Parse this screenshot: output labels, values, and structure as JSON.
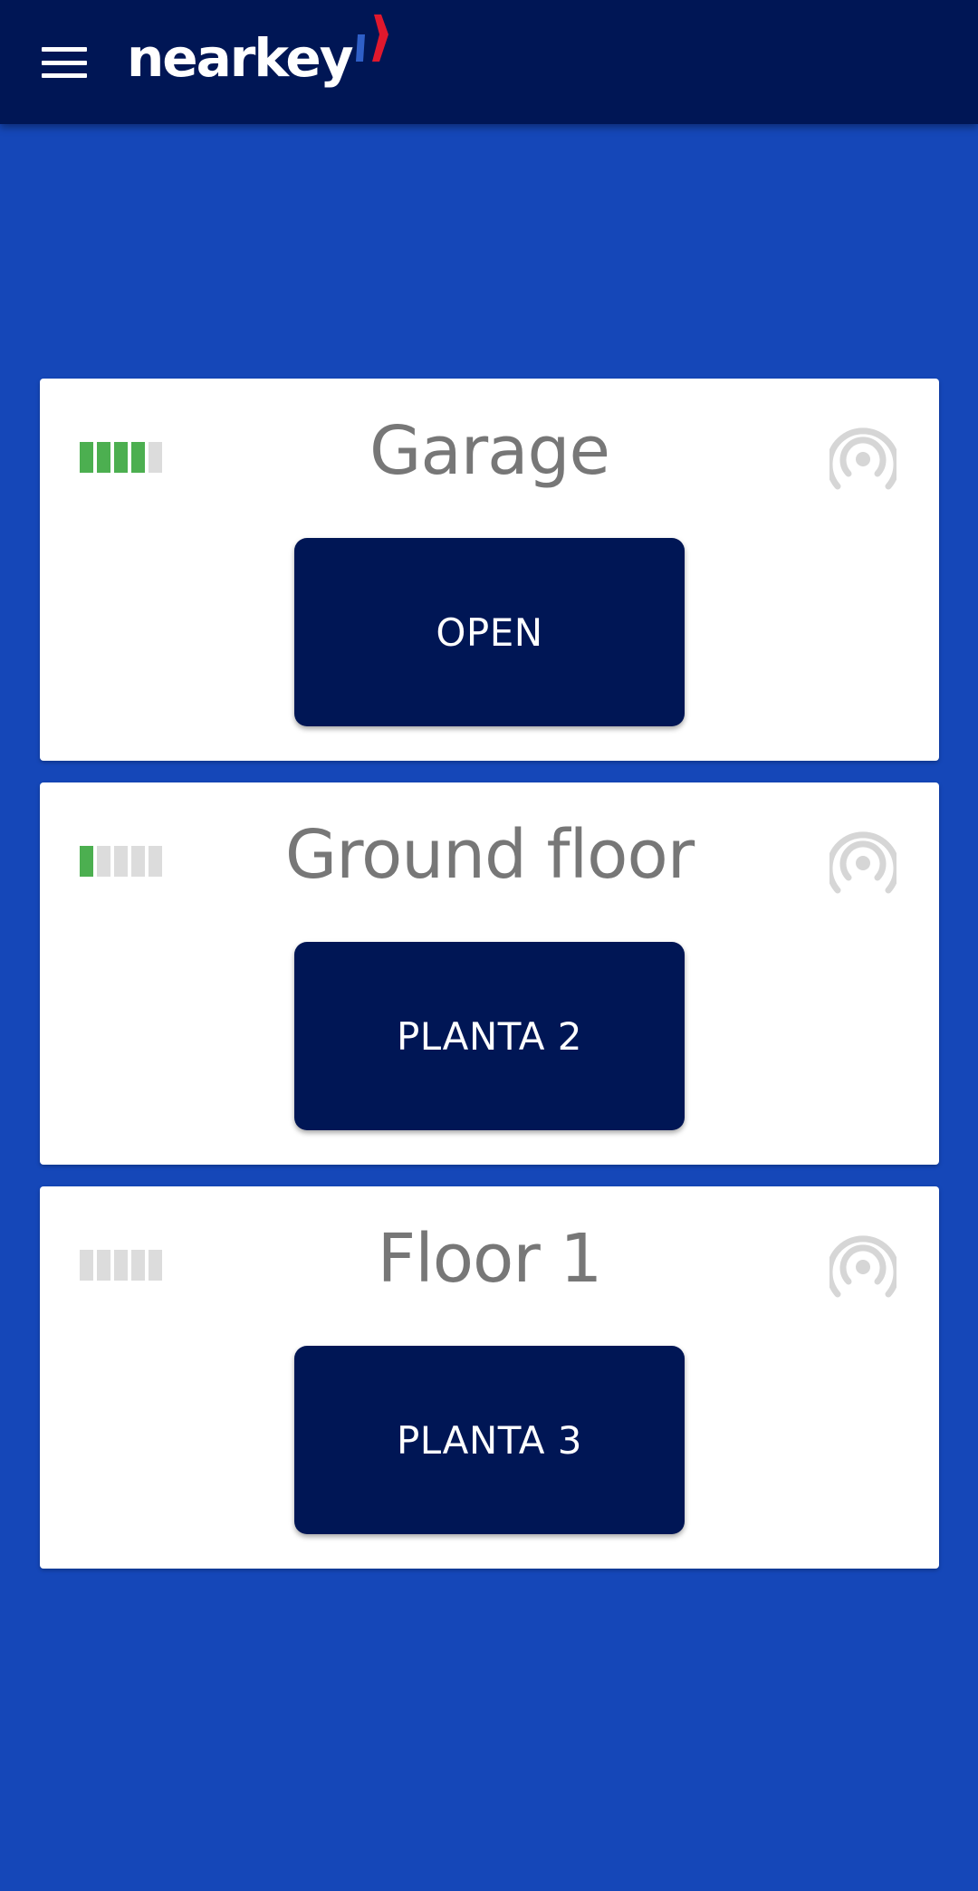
{
  "app_bar": {
    "logo_text": "nearkey",
    "menu_icon": "hamburger-menu-icon",
    "background_color": "#001655"
  },
  "colors": {
    "page_background": "#1547b8",
    "signal_on": "#4caf50",
    "signal_off": "#dcdcdc",
    "button_background": "#001655",
    "logo_mark_red": "#e0182d",
    "logo_mark_blue": "#2f5fc8"
  },
  "locks": [
    {
      "title": "Garage",
      "button_label": "OPEN",
      "signal_strength": 4,
      "signal_max": 5,
      "status_icon": "nfc-signal-icon"
    },
    {
      "title": "Ground floor",
      "button_label": "PLANTA 2",
      "signal_strength": 1,
      "signal_max": 5,
      "status_icon": "nfc-signal-icon"
    },
    {
      "title": "Floor 1",
      "button_label": "PLANTA 3",
      "signal_strength": 0,
      "signal_max": 5,
      "status_icon": "nfc-signal-icon"
    }
  ]
}
